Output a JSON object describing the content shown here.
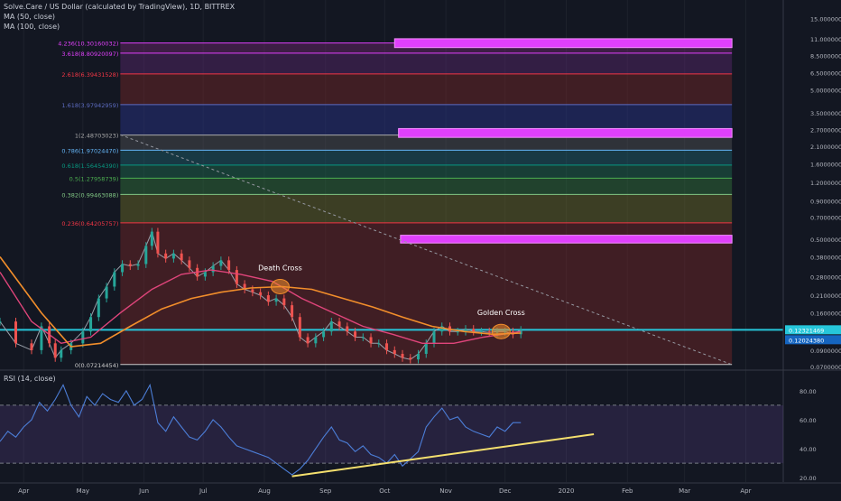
{
  "header": {
    "title": "Solve.Care / US Dollar (calculated by TradingView), 1D, BITTREX",
    "ma50_label": "MA (50, close)",
    "ma100_label": "MA (100, close)",
    "rsi_label": "RSI (14, close)"
  },
  "colors": {
    "background": "#131722",
    "price_line": "#26c6da",
    "ma50": "#e0457b",
    "ma100": "#f28e2b",
    "rsi": "#4c7ed8",
    "trendline": "#f5e06e",
    "marker": "#e040fb"
  },
  "chart_data": [
    {
      "type": "line",
      "title": "Solve.Care / US Dollar (calculated by TradingView), 1D, BITTREX",
      "y_scale": "log",
      "ylim": [
        0.068,
        20
      ],
      "x_ticks": [
        "Apr",
        "May",
        "Jun",
        "Jul",
        "Aug",
        "Sep",
        "Oct",
        "Nov",
        "Dec",
        "2020",
        "Feb",
        "Mar",
        "Apr"
      ],
      "y_ticks": [
        "20.00000000",
        "15.00000000",
        "11.00000000",
        "8.50000000",
        "6.50000000",
        "5.00000000",
        "3.50000000",
        "2.70000000",
        "2.10000000",
        "1.60000000",
        "1.20000000",
        "0.90000000",
        "0.70000000",
        "0.50000000",
        "0.38000000",
        "0.28000000",
        "0.21000000",
        "0.16000000",
        "0.12000000",
        "0.09000000",
        "0.07000000"
      ],
      "current_price_labels": [
        "0.12321469",
        "0.12024380"
      ],
      "series": [
        {
          "name": "Solve.Care / US Dollar",
          "x": [
            "2019-03-20",
            "2019-03-28",
            "2019-04-05",
            "2019-04-10",
            "2019-04-14",
            "2019-04-17",
            "2019-04-20",
            "2019-04-25",
            "2019-05-01",
            "2019-05-05",
            "2019-05-09",
            "2019-05-13",
            "2019-05-17",
            "2019-05-21",
            "2019-05-25",
            "2019-05-29",
            "2019-06-02",
            "2019-06-05",
            "2019-06-08",
            "2019-06-12",
            "2019-06-16",
            "2019-06-20",
            "2019-06-24",
            "2019-06-28",
            "2019-07-02",
            "2019-07-06",
            "2019-07-10",
            "2019-07-14",
            "2019-07-18",
            "2019-07-22",
            "2019-07-26",
            "2019-07-30",
            "2019-08-03",
            "2019-08-07",
            "2019-08-11",
            "2019-08-15",
            "2019-08-19",
            "2019-08-23",
            "2019-08-27",
            "2019-08-31",
            "2019-09-04",
            "2019-09-08",
            "2019-09-12",
            "2019-09-16",
            "2019-09-20",
            "2019-09-24",
            "2019-09-28",
            "2019-10-02",
            "2019-10-06",
            "2019-10-10",
            "2019-10-14",
            "2019-10-18",
            "2019-10-22",
            "2019-10-26",
            "2019-10-30",
            "2019-11-03",
            "2019-11-07",
            "2019-11-11",
            "2019-11-15",
            "2019-11-19",
            "2019-11-23",
            "2019-11-27",
            "2019-12-01",
            "2019-12-05",
            "2019-12-09"
          ],
          "y": [
            0.14,
            0.1,
            0.09,
            0.13,
            0.1,
            0.08,
            0.09,
            0.1,
            0.12,
            0.15,
            0.2,
            0.24,
            0.3,
            0.34,
            0.33,
            0.34,
            0.45,
            0.56,
            0.4,
            0.37,
            0.4,
            0.36,
            0.32,
            0.28,
            0.3,
            0.33,
            0.36,
            0.31,
            0.25,
            0.23,
            0.22,
            0.21,
            0.19,
            0.2,
            0.18,
            0.15,
            0.11,
            0.1,
            0.11,
            0.12,
            0.14,
            0.13,
            0.12,
            0.11,
            0.11,
            0.1,
            0.1,
            0.09,
            0.085,
            0.08,
            0.078,
            0.085,
            0.1,
            0.12,
            0.13,
            0.12,
            0.12,
            0.125,
            0.12,
            0.12,
            0.118,
            0.12,
            0.12,
            0.115,
            0.123
          ]
        },
        {
          "name": "MA (50, close)",
          "x": [
            "2019-03-20",
            "2019-04-05",
            "2019-04-20",
            "2019-05-05",
            "2019-05-20",
            "2019-06-05",
            "2019-06-20",
            "2019-07-05",
            "2019-07-20",
            "2019-08-05",
            "2019-08-20",
            "2019-09-05",
            "2019-09-20",
            "2019-10-05",
            "2019-10-20",
            "2019-11-05",
            "2019-11-20",
            "2019-12-09"
          ],
          "y": [
            0.3,
            0.14,
            0.1,
            0.11,
            0.16,
            0.23,
            0.29,
            0.31,
            0.29,
            0.26,
            0.2,
            0.16,
            0.13,
            0.115,
            0.1,
            0.1,
            0.11,
            0.12
          ]
        },
        {
          "name": "MA (100, close)",
          "x": [
            "2019-03-20",
            "2019-04-10",
            "2019-04-25",
            "2019-05-10",
            "2019-05-25",
            "2019-06-10",
            "2019-06-25",
            "2019-07-10",
            "2019-07-25",
            "2019-08-10",
            "2019-08-25",
            "2019-09-10",
            "2019-09-25",
            "2019-10-10",
            "2019-10-25",
            "2019-11-10",
            "2019-11-25",
            "2019-12-09"
          ],
          "y": [
            0.38,
            0.16,
            0.095,
            0.1,
            0.13,
            0.17,
            0.2,
            0.22,
            0.235,
            0.24,
            0.23,
            0.2,
            0.175,
            0.15,
            0.13,
            0.12,
            0.115,
            0.117
          ]
        }
      ],
      "fib_levels": [
        {
          "label": "0(0.07214454)",
          "value": 0.07214454
        },
        {
          "label": "0.236(0.64205757)",
          "value": 0.64205757
        },
        {
          "label": "0.382(0.99463088)",
          "value": 0.99463088
        },
        {
          "label": "0.5(1.27958739)",
          "value": 1.27958739
        },
        {
          "label": "0.618(1.56454390)",
          "value": 1.5645439
        },
        {
          "label": "0.786(1.97024470)",
          "value": 1.9702447
        },
        {
          "label": "1(2.48703023)",
          "value": 2.48703023
        },
        {
          "label": "1.618(3.97942959)",
          "value": 3.97942959
        },
        {
          "label": "2.618(6.39431528)",
          "value": 6.39431528
        },
        {
          "label": "3.618(8.80920097)",
          "value": 8.80920097
        },
        {
          "label": "4.236(10.30160032)",
          "value": 10.30160032
        }
      ],
      "annotations": [
        {
          "text": "Death Cross",
          "x": "2019-08-09",
          "y": 0.24
        },
        {
          "text": "Golden Cross",
          "x": "2019-11-29",
          "y": 0.12
        }
      ],
      "targets": [
        {
          "x_start": "2019-10-06",
          "x_end": "2020-03-25",
          "low": 9.6,
          "high": 11.0
        },
        {
          "x_start": "2019-10-08",
          "x_end": "2020-03-25",
          "low": 2.4,
          "high": 2.75
        },
        {
          "x_start": "2019-10-09",
          "x_end": "2020-03-25",
          "low": 0.47,
          "high": 0.53
        }
      ],
      "trendline_price": {
        "x": [
          "2019-05-20",
          "2020-03-25"
        ],
        "y": [
          2.5,
          0.072
        ]
      }
    },
    {
      "type": "line",
      "title": "RSI (14, close)",
      "ylim": [
        17,
        93
      ],
      "y_ticks": [
        "80.00",
        "60.00",
        "40.00",
        "20.00"
      ],
      "bands": [
        30,
        70
      ],
      "series": [
        {
          "name": "RSI (14, close)",
          "x": [
            "2019-03-20",
            "2019-03-24",
            "2019-03-28",
            "2019-04-01",
            "2019-04-05",
            "2019-04-09",
            "2019-04-13",
            "2019-04-17",
            "2019-04-21",
            "2019-04-25",
            "2019-04-29",
            "2019-05-03",
            "2019-05-07",
            "2019-05-11",
            "2019-05-15",
            "2019-05-19",
            "2019-05-23",
            "2019-05-27",
            "2019-05-31",
            "2019-06-04",
            "2019-06-08",
            "2019-06-12",
            "2019-06-16",
            "2019-06-20",
            "2019-06-24",
            "2019-06-28",
            "2019-07-02",
            "2019-07-06",
            "2019-07-10",
            "2019-07-14",
            "2019-07-18",
            "2019-07-22",
            "2019-07-26",
            "2019-07-30",
            "2019-08-03",
            "2019-08-07",
            "2019-08-11",
            "2019-08-15",
            "2019-08-19",
            "2019-08-23",
            "2019-08-27",
            "2019-08-31",
            "2019-09-04",
            "2019-09-08",
            "2019-09-12",
            "2019-09-16",
            "2019-09-20",
            "2019-09-24",
            "2019-09-28",
            "2019-10-02",
            "2019-10-06",
            "2019-10-10",
            "2019-10-14",
            "2019-10-18",
            "2019-10-22",
            "2019-10-26",
            "2019-10-30",
            "2019-11-03",
            "2019-11-07",
            "2019-11-11",
            "2019-11-15",
            "2019-11-19",
            "2019-11-23",
            "2019-11-27",
            "2019-12-01",
            "2019-12-05",
            "2019-12-09"
          ],
          "y": [
            45,
            52,
            48,
            55,
            60,
            72,
            66,
            74,
            84,
            70,
            62,
            76,
            70,
            78,
            74,
            72,
            80,
            70,
            74,
            84,
            58,
            52,
            62,
            55,
            48,
            46,
            52,
            60,
            55,
            48,
            42,
            40,
            38,
            36,
            34,
            30,
            26,
            22,
            26,
            32,
            40,
            48,
            55,
            46,
            44,
            38,
            42,
            36,
            34,
            30,
            36,
            28,
            33,
            38,
            55,
            62,
            68,
            60,
            62,
            55,
            52,
            50,
            48,
            55,
            52,
            58,
            58
          ]
        }
      ],
      "trendline_rsi": {
        "x": [
          "2019-08-15",
          "2020-01-15"
        ],
        "y": [
          21,
          50
        ]
      }
    }
  ]
}
